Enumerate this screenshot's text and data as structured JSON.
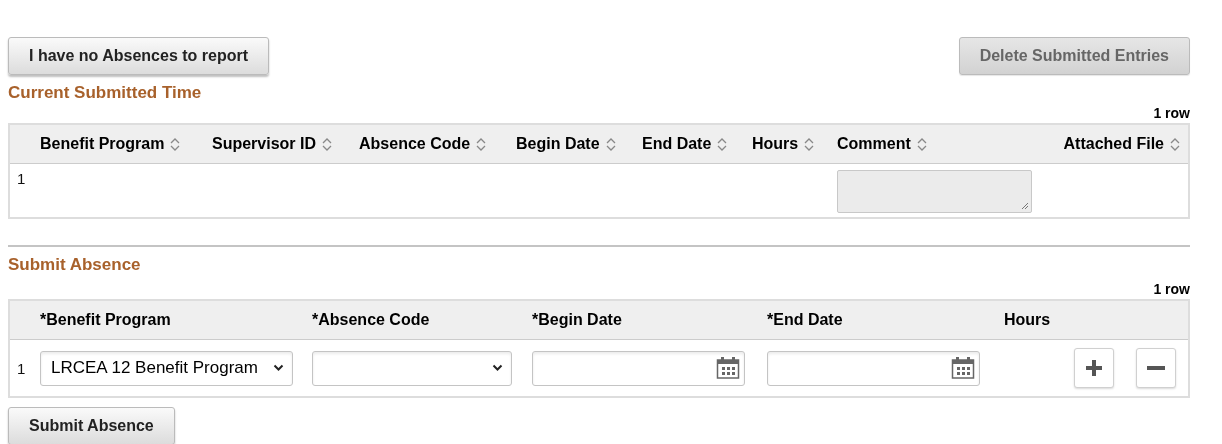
{
  "top_buttons": [
    {
      "label": "I have no Absences to report",
      "disabled": false
    },
    {
      "label": "Delete Submitted Entries",
      "disabled": true
    }
  ],
  "submitted_time": {
    "title": "Current Submitted Time",
    "row_count": "1 row",
    "columns": [
      "Benefit Program",
      "Supervisor ID",
      "Absence Code",
      "Begin Date",
      "End Date",
      "Hours",
      "Comment",
      "Attached File"
    ],
    "rows": [
      {
        "number": "1",
        "comment_disabled": true
      }
    ]
  },
  "submit_absence": {
    "title": "Submit Absence",
    "row_count": "1 row",
    "columns": [
      "*Benefit Program",
      "*Absence Code",
      "*Begin Date",
      "*End Date",
      "Hours"
    ],
    "rows": [
      {
        "number": "1",
        "benefit_program": "LRCEA 12 Benefit Program"
      }
    ]
  },
  "submit_button": {
    "label": "Submit Absence"
  }
}
